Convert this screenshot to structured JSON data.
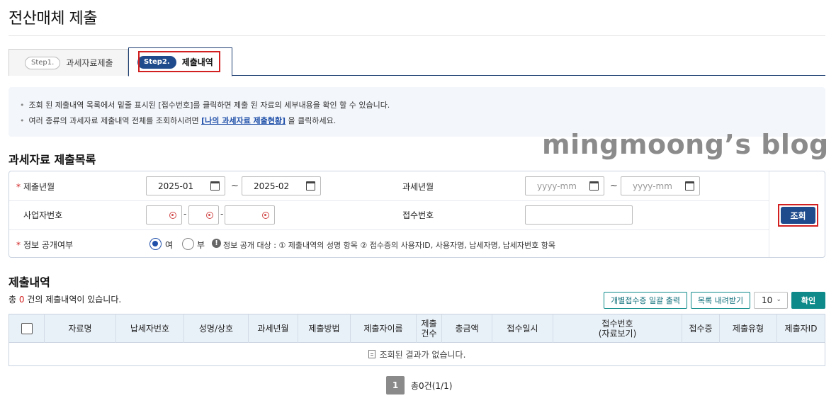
{
  "page": {
    "title": "전산매체 제출"
  },
  "tabs": [
    {
      "step": "Step1.",
      "label": "과세자료제출"
    },
    {
      "step": "Step2.",
      "label": "제출내역"
    }
  ],
  "info": {
    "line1": "조회 된 제출내역 목록에서 밑줄 표시된 [접수번호]를 클릭하면 제출 된 자료의 세부내용을 확인 할 수 있습니다.",
    "line2_pre": "여러 종류의 과세자료 제출내역 전체를 조회하시려면 ",
    "line2_link": "[나의 과세자료 제출현황]",
    "line2_post": " 을 클릭하세요."
  },
  "watermark": "mingmoong’s blog",
  "search": {
    "section_title": "과세자료 제출목록",
    "submit_month_label": "제출년월",
    "submit_from": "2025-01",
    "submit_to": "2025-02",
    "tax_month_label": "과세년월",
    "tax_from_placeholder": "yyyy-mm",
    "tax_to_placeholder": "yyyy-mm",
    "tilde": "~",
    "biz_no_label": "사업자번호",
    "dash": "-",
    "receipt_no_label": "접수번호",
    "disclosure_label": "정보 공개여부",
    "radio_yes": "여",
    "radio_no": "부",
    "disclosure_note": "정보 공개 대상 : ① 제출내역의 성명 항목 ② 접수증의 사용자ID, 사용자명, 납세자명, 납세자번호 항목",
    "search_button": "조회"
  },
  "results": {
    "section_title": "제출내역",
    "count_prefix": "총 ",
    "count": "0",
    "count_suffix": " 건의 제출내역이 있습니다.",
    "bulk_print_button": "개별접수증 일괄 출력",
    "download_button": "목록 내려받기",
    "page_size": "10",
    "confirm_button": "확인",
    "columns": [
      "자료명",
      "납세자번호",
      "성명/상호",
      "과세년월",
      "제출방법",
      "제출자이름",
      "제출\n건수",
      "총금액",
      "접수일시",
      "접수번호\n(자료보기)",
      "접수증",
      "제출유형",
      "제출자ID"
    ],
    "empty_message": "조회된 결과가 없습니다."
  },
  "pagination": {
    "current": "1",
    "total_text": "총0건(1/1)"
  }
}
